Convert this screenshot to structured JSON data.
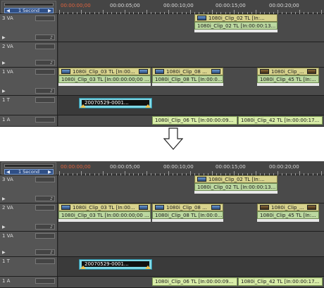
{
  "scale_label": "1 Second",
  "scale_left": "◀",
  "scale_right": "▶",
  "timecodes": [
    "00:00:00;00",
    "00:00:05;00",
    "00:00:10;00",
    "00:00:15;00",
    "00:00:20;00"
  ],
  "top": {
    "tracks": [
      "3 VA",
      "2 VA",
      "1 VA",
      "1 T",
      "1 A"
    ],
    "clip_3va": {
      "video": "1080i_Clip_02  TL [In:...",
      "audio": "1080i_Clip_02  TL [In:00:00:13..."
    },
    "clip_1va_a": {
      "video": "1080i_Clip_03  TL [In:00...",
      "audio": "1080i_Clip_03  TL [In:00:00:00;00 ..."
    },
    "clip_1va_b": {
      "video": "1080i_Clip_08  ...",
      "audio": "1080i_Clip_08  TL [In:00:0..."
    },
    "clip_1va_c": {
      "video": "1080i_Clip_...",
      "audio": "1080i_Clip_45  TL [In:..."
    },
    "title_clip": "20070529-0001...",
    "audio_a": "1080i_Clip_06  TL [In:00:00:09...",
    "audio_b": "1080i_Clip_42  TL [In:00:00:17..."
  },
  "bottom": {
    "tracks": [
      "3 VA",
      "2 VA",
      "1 VA",
      "1 T",
      "1 A"
    ],
    "clip_3va": {
      "video": "1080i_Clip_02  TL [In:...",
      "audio": "1080i_Clip_02  TL [In:00:00:13..."
    },
    "clip_2va_a": {
      "video": "1080i_Clip_03  TL [In:00...",
      "audio": "1080i_Clip_03  TL [In:00:00:00;00 ..."
    },
    "clip_2va_b": {
      "video": "1080i_Clip_08  ...",
      "audio": "1080i_Clip_08  TL [In:00:0..."
    },
    "clip_2va_c": {
      "video": "1080i_Clip_...",
      "audio": "1080i_Clip_45  TL [In:..."
    },
    "title_clip": "20070529-0001...",
    "audio_a": "1080i_Clip_06  TL [In:00:00:09...",
    "audio_b": "1080i_Clip_42  TL [In:00:00:17..."
  }
}
